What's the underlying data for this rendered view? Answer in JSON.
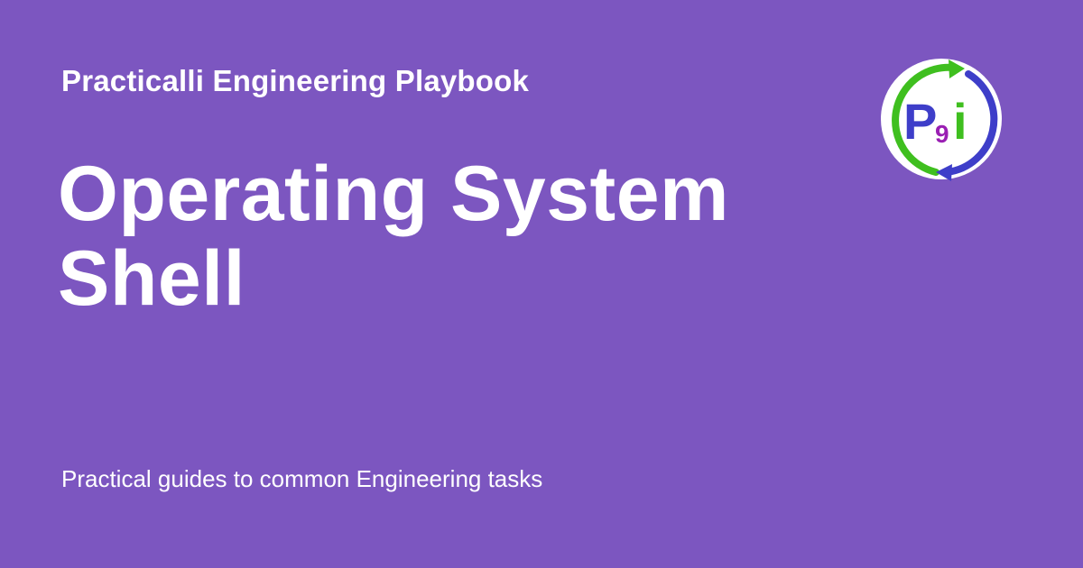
{
  "colors": {
    "background": "#7c56c0",
    "text": "#ffffff",
    "logo_green": "#3fbf1f",
    "logo_blue": "#3e3ec9",
    "logo_purple": "#9a1fb3"
  },
  "header": {
    "site_name": "Practicalli Engineering Playbook"
  },
  "main": {
    "title": "Operating System Shell"
  },
  "footer": {
    "tagline": "Practical guides to common Engineering tasks"
  },
  "logo": {
    "icon": "practicalli-logo-icon",
    "letter_p": "P",
    "letter_9": "9",
    "letter_i": "i"
  }
}
